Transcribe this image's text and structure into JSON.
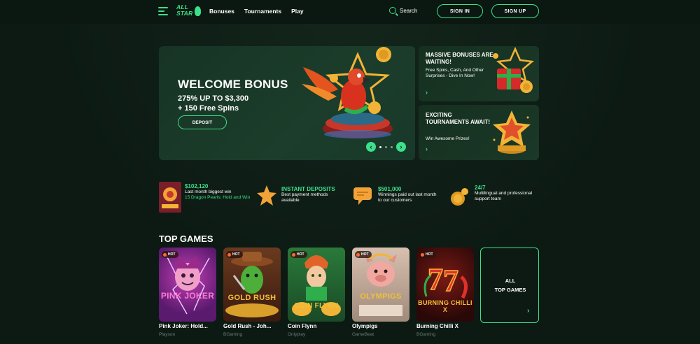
{
  "header": {
    "logo_text": "ALL STAR",
    "nav": [
      "Bonuses",
      "Tournaments",
      "Play"
    ],
    "search_label": "Search",
    "signin_label": "SIGN IN",
    "signup_label": "SIGN UP"
  },
  "hero": {
    "title": "WELCOME BONUS",
    "line1": "275% UP TO $3,300",
    "line2": "+ 150 Free Spins",
    "button": "DEPOSIT",
    "prev": "‹",
    "next": "›"
  },
  "promos": [
    {
      "title": "MASSIVE BONUSES ARE WAITING!",
      "desc": "Free Spins, Cash, And Other Surprises - Dive In Now!",
      "chevron": "›"
    },
    {
      "title": "EXCITING TOURNAMENTS AWAIT!",
      "desc": "Win Awesome Prizes!",
      "chevron": "›"
    }
  ],
  "features": {
    "win": {
      "amount": "$102,120",
      "label": "Last month biggest win",
      "game": "15 Dragon Pearls: Hold and Win"
    },
    "deposits": {
      "title": "INSTANT DEPOSITS",
      "text": "Best payment methods available"
    },
    "paid": {
      "title": "$501,000",
      "text": "Winnings paid out last month to our customers"
    },
    "support": {
      "title": "24/7",
      "text": "Multilingual and professional support team"
    }
  },
  "top_games": {
    "title": "TOP GAMES",
    "hot_label": "HOT",
    "games": [
      {
        "name": "Pink Joker: Hold...",
        "provider": "Playson",
        "logo": "PINK JOKER"
      },
      {
        "name": "Gold Rush - Joh...",
        "provider": "BGaming",
        "logo": "GOLD RUSH"
      },
      {
        "name": "Coin Flynn",
        "provider": "Onlyplay",
        "logo": "COIN FLYNN"
      },
      {
        "name": "Olympigs",
        "provider": "GameBeat",
        "logo": "OLYMPIGS"
      },
      {
        "name": "Burning Chilli X",
        "provider": "BGaming",
        "logo": "BURNING CHILLI X"
      }
    ],
    "all_line1": "ALL",
    "all_line2": "TOP GAMES",
    "all_chevron": "›"
  },
  "colors": {
    "accent": "#3de08a",
    "background": "#0c1a13",
    "card": "#1c3d2b"
  },
  "icons": [
    "menu-icon",
    "search-icon",
    "chevron-left-icon",
    "chevron-right-icon",
    "star-icon",
    "speech-bubble-icon",
    "coins-icon",
    "gift-icon",
    "trophy-icon",
    "hot-flame-icon"
  ]
}
